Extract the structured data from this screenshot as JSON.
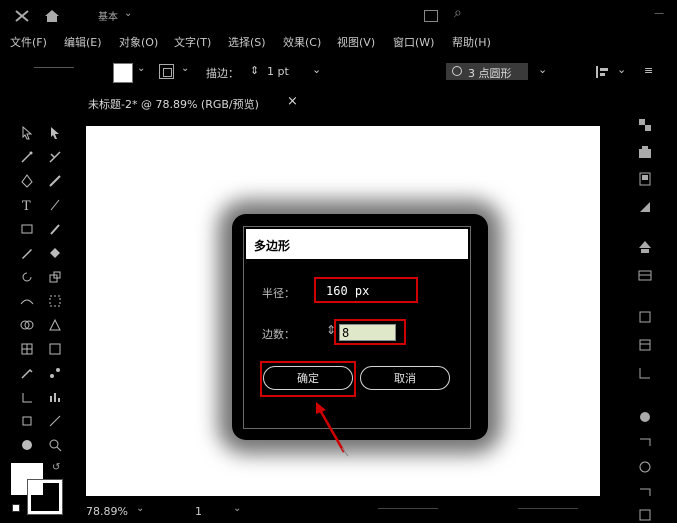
{
  "menubar": {
    "items": [
      "文件(F)",
      "编辑(E)",
      "对象(O)",
      "文字(T)",
      "选择(S)",
      "效果(C)",
      "视图(V)",
      "窗口(W)",
      "帮助(H)"
    ]
  },
  "titlebar": {
    "workspace_label": "基本"
  },
  "control_bar": {
    "stroke_label": "描边：",
    "stroke_value": "1 pt",
    "brush_label": "3 点圆形"
  },
  "document_tab": {
    "label": "未标题-2* @ 78.89% (RGB/预览)",
    "close": "×"
  },
  "dialog": {
    "title": "多边形",
    "radius_label": "半径：",
    "radius_value": "160 px",
    "sides_label": "边数：",
    "sides_value": "8",
    "ok_label": "确定",
    "cancel_label": "取消"
  },
  "statusbar": {
    "zoom": "78.89%",
    "artboard_number": "1"
  },
  "colors": {
    "highlight": "#d10000",
    "artboard": "#ffffff",
    "background": "#000000"
  }
}
